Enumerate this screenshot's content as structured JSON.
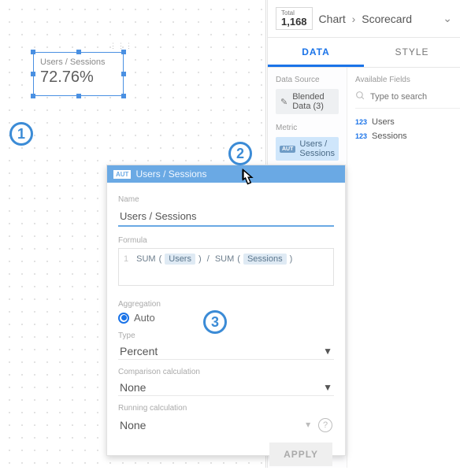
{
  "header": {
    "total_label": "Total",
    "total_value": "1,168",
    "crumb1": "Chart",
    "crumb2": "Scorecard"
  },
  "tabs": {
    "data": "DATA",
    "style": "STYLE"
  },
  "data_panel": {
    "data_source_title": "Data Source",
    "data_source_value": "Blended Data (3)",
    "metric_title": "Metric",
    "metric_badge": "AUT",
    "metric_value": "Users / Sessions"
  },
  "fields_panel": {
    "title": "Available Fields",
    "placeholder": "Type to search",
    "items": [
      "Users",
      "Sessions"
    ]
  },
  "scorecard": {
    "label": "Users / Sessions",
    "value": "72.76%"
  },
  "popup": {
    "aut": "AUT",
    "title": "Users / Sessions",
    "name_label": "Name",
    "name_value": "Users / Sessions",
    "formula_label": "Formula",
    "formula_fn": "SUM",
    "formula_f1": "Users",
    "formula_f2": "Sessions",
    "agg_label": "Aggregation",
    "agg_value": "Auto",
    "type_label": "Type",
    "type_value": "Percent",
    "comp_label": "Comparison calculation",
    "comp_value": "None",
    "run_label": "Running calculation",
    "run_value": "None",
    "apply": "APPLY"
  },
  "annotations": {
    "1": "1",
    "2": "2",
    "3": "3"
  }
}
